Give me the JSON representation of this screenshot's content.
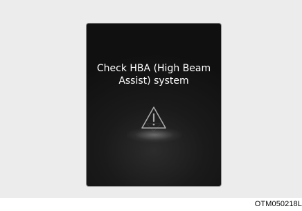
{
  "display": {
    "message_line1": "Check HBA (High Beam",
    "message_line2": "Assist) system",
    "icon": "warning-triangle-icon"
  },
  "figure_code": "OTM050218L",
  "colors": {
    "screen_background": "#121212",
    "message_text": "#ffffff",
    "icon_stroke": "#a8a8a8",
    "page_backdrop": "#ececec"
  }
}
